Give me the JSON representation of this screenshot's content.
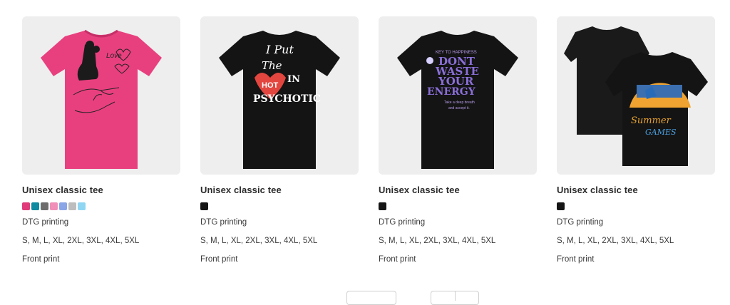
{
  "products": [
    {
      "title": "Unisex classic tee",
      "swatches": [
        "#e03a7a",
        "#0f8aa0",
        "#6d6d6d",
        "#f08fb7",
        "#8aa6e6",
        "#bdbdbd",
        "#8fd6f2"
      ],
      "printing": "DTG printing",
      "sizes": "S, M, L, XL, 2XL, 3XL, 4XL, 5XL",
      "print_location": "Front print",
      "shirt_color": "#e8407f",
      "design": {
        "text1": "Love"
      }
    },
    {
      "title": "Unisex classic tee",
      "swatches": [
        "#151515"
      ],
      "printing": "DTG printing",
      "sizes": "S, M, L, XL, 2XL, 3XL, 4XL, 5XL",
      "print_location": "Front print",
      "shirt_color": "#141414",
      "design": {
        "line1": "I Put",
        "line2": "The",
        "heart": "HOT",
        "line3": "IN",
        "line4": "PSYCHOTIC"
      }
    },
    {
      "title": "Unisex classic tee",
      "swatches": [
        "#151515"
      ],
      "printing": "DTG printing",
      "sizes": "S, M, L, XL, 2XL, 3XL, 4XL, 5XL",
      "print_location": "Front print",
      "shirt_color": "#141414",
      "design": {
        "top": "KEY TO HAPPINESS",
        "l1": "DONT",
        "l2": "WASTE",
        "l3": "YOUR",
        "l4": "ENERGY",
        "small1": "Take a deep breath",
        "small2": "and accept it."
      }
    },
    {
      "title": "Unisex classic tee",
      "swatches": [
        "#151515"
      ],
      "printing": "DTG printing",
      "sizes": "S, M, L, XL, 2XL, 3XL, 4XL, 5XL",
      "print_location": "Front print",
      "shirt_color": "#141414",
      "design": {
        "l1": "Summer",
        "l2": "GAMES"
      }
    }
  ]
}
